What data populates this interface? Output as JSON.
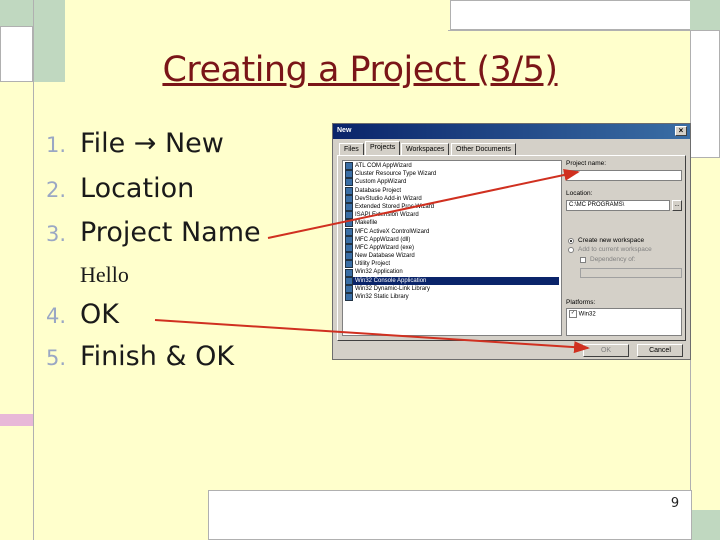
{
  "slide": {
    "title": "Creating a Project (3/5)",
    "steps": [
      {
        "num": "1.",
        "text": "File → New"
      },
      {
        "num": "2.",
        "text": "Location"
      },
      {
        "num": "3.",
        "text": "Project Name"
      },
      {
        "num": "4.",
        "text": "OK"
      },
      {
        "num": "5.",
        "text": "Finish & OK"
      }
    ],
    "sub_item": "Hello",
    "page_number": "9"
  },
  "dialog": {
    "title": "New",
    "tabs": [
      "Files",
      "Projects",
      "Workspaces",
      "Other Documents"
    ],
    "active_tab": "Projects",
    "project_types": [
      "ATL COM AppWizard",
      "Cluster Resource Type Wizard",
      "Custom AppWizard",
      "Database Project",
      "DevStudio Add-in Wizard",
      "Extended Stored Proc Wizard",
      "ISAPI Extension Wizard",
      "Makefile",
      "MFC ActiveX ControlWizard",
      "MFC AppWizard (dll)",
      "MFC AppWizard (exe)",
      "New Database Wizard",
      "Utility Project",
      "Win32 Application",
      "Win32 Console Application",
      "Win32 Dynamic-Link Library",
      "Win32 Static Library"
    ],
    "selected_index": 14,
    "project_name_label": "Project name:",
    "project_name_value": "",
    "location_label": "Location:",
    "location_value": "C:\\MC PROGRAMS\\",
    "browse_label": "...",
    "radio_create": "Create new workspace",
    "radio_add": "Add to current workspace",
    "dependency_label": "Dependency of:",
    "platforms_label": "Platforms:",
    "platform_item": "Win32",
    "ok_label": "OK",
    "cancel_label": "Cancel"
  },
  "colors": {
    "title": "#7a1518",
    "arrow": "#d03020",
    "slide_bg": "#ffffcc"
  }
}
